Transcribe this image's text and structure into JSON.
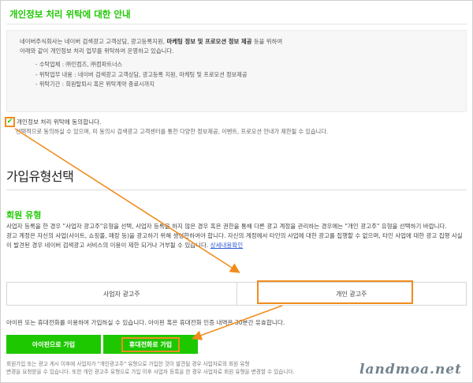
{
  "consent": {
    "title": "개인정보 처리 위탁에 대한 안내",
    "intro_line1_pre": "네이버주식회사는 네이버 검색광고 고객상담, 광고등록지원, ",
    "intro_line1_bold": "마케팅 정보 및 프로모션 정보 제공",
    "intro_line1_post": " 등을 위하여",
    "intro_line2": "아래와 같이 개인정보 처리 업무를 위탁하여 운영하고 있습니다.",
    "list": [
      "- 수탁업체 : ㈜인컴즈, ㈜컴파트너스",
      "- 위탁업무 내용 : 네이버 검색광고 고객상담, 광고등록 지원, 마케팅 및 프로모션 정보제공",
      "- 위탁기간 : 회원탈퇴시 혹은 위탁계약 종료시까지"
    ],
    "checkbox_label": "개인정보 처리 위탁에 동의합니다.",
    "checkbox_checked": true,
    "note": "선택적으로 동의하실 수 있으며, 미 동의시 검색광고 고객센터를 통한 다양한 정보제공, 이벤트, 프로모션 안내가 제한될 수 있습니다."
  },
  "signup_type": {
    "section_title": "가입유형선택",
    "member_type_title": "회원 유형",
    "desc1": "사업자 등록을 한 경우 \"사업자 광고주\"유형을 선택, 사업자 등록을 하지 않은 경우 혹은 권한을 통해 다른 광고 계정을 관리하는 경우에는 \"개인 광고주\" 유형을 선택하기 바랍니다.",
    "desc2": "광고 계정은 자신의 사업(사이트, 쇼핑몰, 매장 등)을 광고하기 위해 생성한하여야 합니다. 자신의 계정에서 타인의 사업에 대한 광고를 집행할 수 없으며, 타인 사업에 대한 광고 집행 사실이 발견된 경우 네이버 검색광고 서비스의 이용이 제한 되거나 거부될 수 있습니다. ",
    "detail_link": "상세내용확인",
    "tabs": [
      "사업자 광고주",
      "개인 광고주"
    ],
    "selected_tab": "개인 광고주",
    "notice": "아이핀 또는 휴대전화를 이용하여 가입하실 수 있습니다. 아이핀 혹은 휴대전화 인증 내역은 30분간 유효합니다.",
    "btn_ipin": "아이핀으로 가입",
    "btn_phone": "휴대전화로 가입",
    "footer1": "회원가입 또는 광고 게시 이후에 사업자가 \"개인광고주\" 유형으로 가입한 것이 발견될 경우 사업자로의 회원 유형",
    "footer2": "변경을 요청받을 수 있습니다. 또한 개인 광고주 유형으로 가입 이후 사업자 등록을 한 경우 사업자로 회원 유형을 변경할 수 있습니다."
  },
  "watermark": "landmoa.net",
  "colors": {
    "brand_green": "#1ec800",
    "annotation_orange": "#f08c1e",
    "link_blue": "#2e5bd0"
  }
}
